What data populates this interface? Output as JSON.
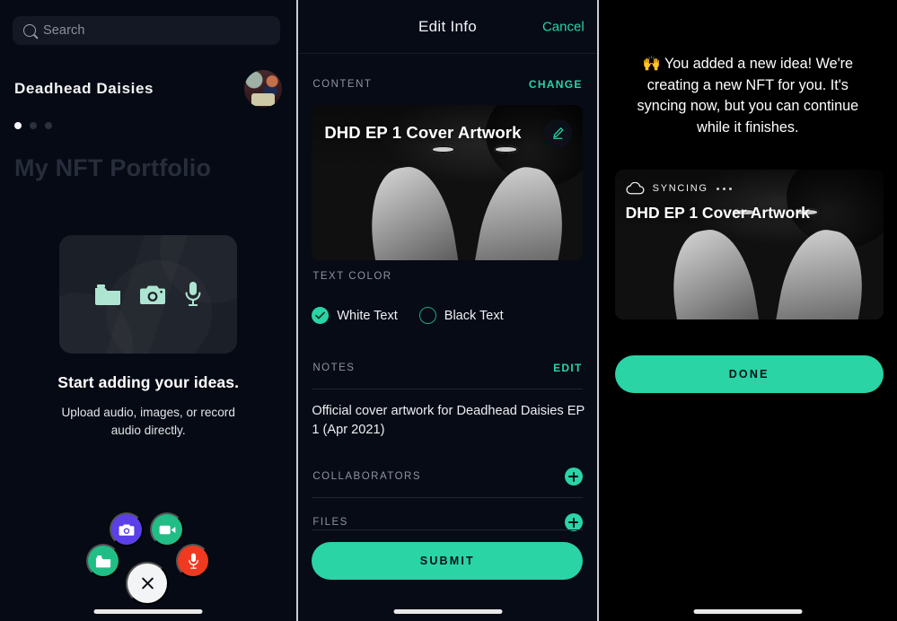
{
  "colors": {
    "accent_green": "#2AD4A4",
    "purple": "#5B3FE8",
    "red": "#F03A20",
    "green_fab": "#21BD86",
    "mint_icon": "#AEE5D2",
    "left_bg": "#060A14",
    "mid_bg": "#070B16",
    "right_bg": "#000000"
  },
  "left_panel": {
    "search": {
      "placeholder": "Search",
      "icon": "search-icon"
    },
    "brand_name": "Deadhead Daisies",
    "avatar_icon": "user-avatar",
    "page_dots": {
      "count": 3,
      "active_index": 0
    },
    "portfolio_title": "My NFT Portfolio",
    "placeholder_card": {
      "icons": [
        "folder-icon",
        "camera-icon",
        "microphone-icon"
      ]
    },
    "empty_title": "Start adding your ideas.",
    "empty_subtitle": "Upload audio, images, or record audio directly.",
    "fab": {
      "camera_label": "camera-icon",
      "video_label": "video-camera-icon",
      "folder_label": "folder-icon",
      "mic_label": "microphone-icon",
      "close_label": "close-icon"
    }
  },
  "mid_panel": {
    "title": "Edit Info",
    "cancel_label": "Cancel",
    "content": {
      "label": "CONTENT",
      "action": "CHANGE",
      "artwork_title": "DHD EP 1 Cover Artwork",
      "edit_icon": "pencil-icon"
    },
    "text_color": {
      "label": "TEXT COLOR",
      "options": [
        {
          "label": "White Text",
          "selected": true
        },
        {
          "label": "Black Text",
          "selected": false
        }
      ]
    },
    "notes": {
      "label": "NOTES",
      "action": "EDIT",
      "value": "Official cover artwork for Deadhead Daisies EP 1 (Apr 2021)"
    },
    "collaborators": {
      "label": "COLLABORATORS",
      "add_icon": "plus-icon"
    },
    "files": {
      "label": "FILES",
      "add_icon": "plus-icon"
    },
    "submit_label": "SUBMIT"
  },
  "right_panel": {
    "toast_message": "🙌 You added a new idea! We're creating a new NFT for you. It's syncing now, but you can continue while it finishes.",
    "sync_card": {
      "status_label": "SYNCING",
      "status_icon": "cloud-icon",
      "title": "DHD EP 1 Cover Artwork"
    },
    "done_label": "DONE"
  }
}
